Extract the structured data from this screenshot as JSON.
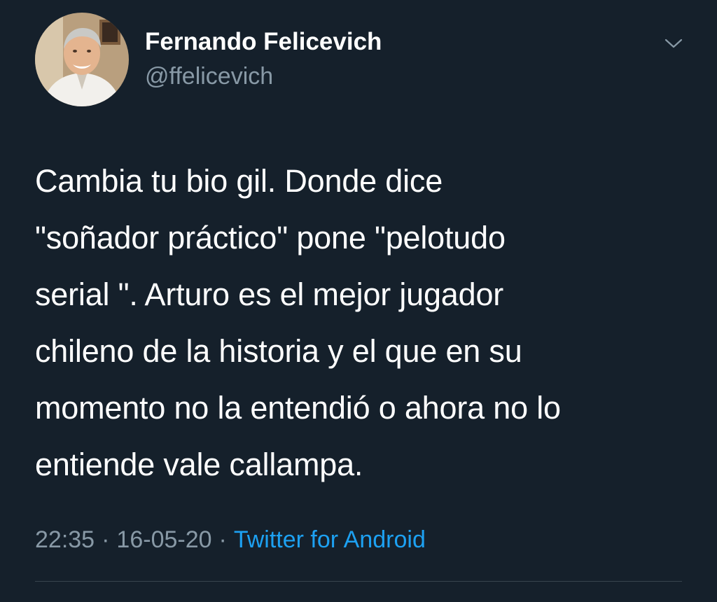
{
  "tweet": {
    "author": {
      "display_name": "Fernando Felicevich",
      "handle": "@ffelicevich",
      "avatar": "profile-photo"
    },
    "menu_icon": "chevron-down-icon",
    "text": "Cambia tu bio gil. Donde dice\n\"soñador práctico\" pone \"pelotudo\nserial \". Arturo es el mejor jugador\nchileno de la historia y el que en su\nmomento no la entendió o ahora no lo\nentiende vale callampa.",
    "time": "22:35",
    "separator": "·",
    "date": "16-05-20",
    "source": "Twitter for Android"
  },
  "colors": {
    "background": "#15202b",
    "text_primary": "#ffffff",
    "text_secondary": "#8899a6",
    "link": "#1da1f2",
    "divider": "#38444d"
  }
}
